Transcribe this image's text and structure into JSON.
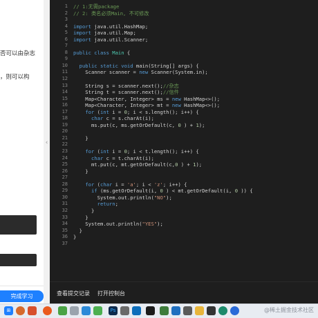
{
  "left_panel": {
    "text_lines": [
      "否可以由杂志",
      "，则可以构"
    ],
    "finish_button": "完成学习"
  },
  "code": {
    "lines": [
      [
        [
          "cm",
          "// 1:无需package"
        ]
      ],
      [
        [
          "cm",
          "// 2: 类名必须Main, 不可修改"
        ]
      ],
      [],
      [
        [
          "kw",
          "import"
        ],
        [
          "",
          "java.util.HashMap;"
        ]
      ],
      [
        [
          "kw",
          "import"
        ],
        [
          "",
          "java.util.Map;"
        ]
      ],
      [
        [
          "kw",
          "import"
        ],
        [
          "",
          "java.util.Scanner;"
        ]
      ],
      [],
      [
        [
          "kw",
          "public"
        ],
        [
          "",
          ""
        ],
        [
          "kw",
          "class"
        ],
        [
          "",
          ""
        ],
        [
          "ty",
          "Main"
        ],
        [
          "",
          " {"
        ]
      ],
      [],
      [
        [
          "",
          "  "
        ],
        [
          "kw",
          "public"
        ],
        [
          "",
          ""
        ],
        [
          "kw",
          "static"
        ],
        [
          "",
          ""
        ],
        [
          "kw",
          "void"
        ],
        [
          "",
          " main(String[] args) {"
        ]
      ],
      [
        [
          "",
          "    Scanner scanner = "
        ],
        [
          "kw",
          "new"
        ],
        [
          "",
          " Scanner(System.in);"
        ]
      ],
      [],
      [
        [
          "",
          "    String s = scanner.next();"
        ],
        [
          "cm",
          "//杂志"
        ]
      ],
      [
        [
          "",
          "    String t = scanner.next();"
        ],
        [
          "cm",
          "//信件"
        ]
      ],
      [
        [
          "",
          "    Map<Character, Integer> ms = "
        ],
        [
          "kw",
          "new"
        ],
        [
          "",
          " HashMap<>();"
        ]
      ],
      [
        [
          "",
          "    Map<Character, Integer> mt = "
        ],
        [
          "kw",
          "new"
        ],
        [
          "",
          " HashMap<>();"
        ]
      ],
      [
        [
          "",
          "    "
        ],
        [
          "kw",
          "for"
        ],
        [
          "",
          " ("
        ],
        [
          "kw",
          "int"
        ],
        [
          "",
          " i = "
        ],
        [
          "num",
          "0"
        ],
        [
          "",
          "; i < s.length(); i++) {"
        ]
      ],
      [
        [
          "",
          "      "
        ],
        [
          "kw",
          "char"
        ],
        [
          "",
          " c = s.charAt(i);"
        ]
      ],
      [
        [
          "",
          "      ms.put(c, ms.getOrDefault(c, "
        ],
        [
          "num",
          "0"
        ],
        [
          "",
          " ) + "
        ],
        [
          "num",
          "1"
        ],
        [
          "",
          ");"
        ]
      ],
      [],
      [
        [
          "",
          "    }"
        ]
      ],
      [],
      [
        [
          "",
          "    "
        ],
        [
          "kw",
          "for"
        ],
        [
          "",
          " ("
        ],
        [
          "kw",
          "int"
        ],
        [
          "",
          " i = "
        ],
        [
          "num",
          "0"
        ],
        [
          "",
          "; i < t.length(); i++) {"
        ]
      ],
      [
        [
          "",
          "      "
        ],
        [
          "kw",
          "char"
        ],
        [
          "",
          " c = t.charAt(i);"
        ]
      ],
      [
        [
          "",
          "      mt.put(c, mt.getOrDefault(c,"
        ],
        [
          "num",
          "0"
        ],
        [
          "",
          " ) + "
        ],
        [
          "num",
          "1"
        ],
        [
          "",
          ");"
        ]
      ],
      [
        [
          "",
          "    }"
        ]
      ],
      [],
      [
        [
          "",
          "    "
        ],
        [
          "kw",
          "for"
        ],
        [
          "",
          " ("
        ],
        [
          "kw",
          "char"
        ],
        [
          "",
          " i = "
        ],
        [
          "str",
          "'a'"
        ],
        [
          "",
          "; i < "
        ],
        [
          "str",
          "'z'"
        ],
        [
          "",
          "; i++) {"
        ]
      ],
      [
        [
          "",
          "      "
        ],
        [
          "kw",
          "if"
        ],
        [
          "",
          " (ms.getOrDefault(i, "
        ],
        [
          "num",
          "0"
        ],
        [
          "",
          " ) < mt.getOrDefault(i, "
        ],
        [
          "num",
          "0"
        ],
        [
          "",
          " )) {"
        ]
      ],
      [
        [
          "",
          "        System.out.println("
        ],
        [
          "str",
          "\"NO\""
        ],
        [
          "",
          ");"
        ]
      ],
      [
        [
          "",
          "        "
        ],
        [
          "kw",
          "return"
        ],
        [
          "",
          ";"
        ]
      ],
      [
        [
          "",
          "      }"
        ]
      ],
      [
        [
          "",
          "    }"
        ]
      ],
      [
        [
          "",
          "    System.out.println("
        ],
        [
          "str",
          "\"YES\""
        ],
        [
          "",
          ");"
        ]
      ],
      [
        [
          "",
          "  }"
        ]
      ],
      [
        [
          "",
          "}"
        ]
      ],
      []
    ]
  },
  "actions": {
    "view_submissions": "查看提交记录",
    "open_console": "打开控制台"
  },
  "taskbar": {
    "icons": [
      "windows-icon",
      "firefox-icon",
      "wechat-icon",
      "wechat-alt-icon",
      "qq-icon",
      "photoshop-icon",
      "vscode-icon",
      "pycharm-icon",
      "explorer-icon",
      "app-icon",
      "media-icon",
      "settings-icon",
      "terminal-icon",
      "app2-icon",
      "edge-icon",
      "chrome-icon"
    ],
    "colors": {
      "accent": "#1e80ff"
    }
  },
  "watermark": "@稀土掘金技术社区"
}
